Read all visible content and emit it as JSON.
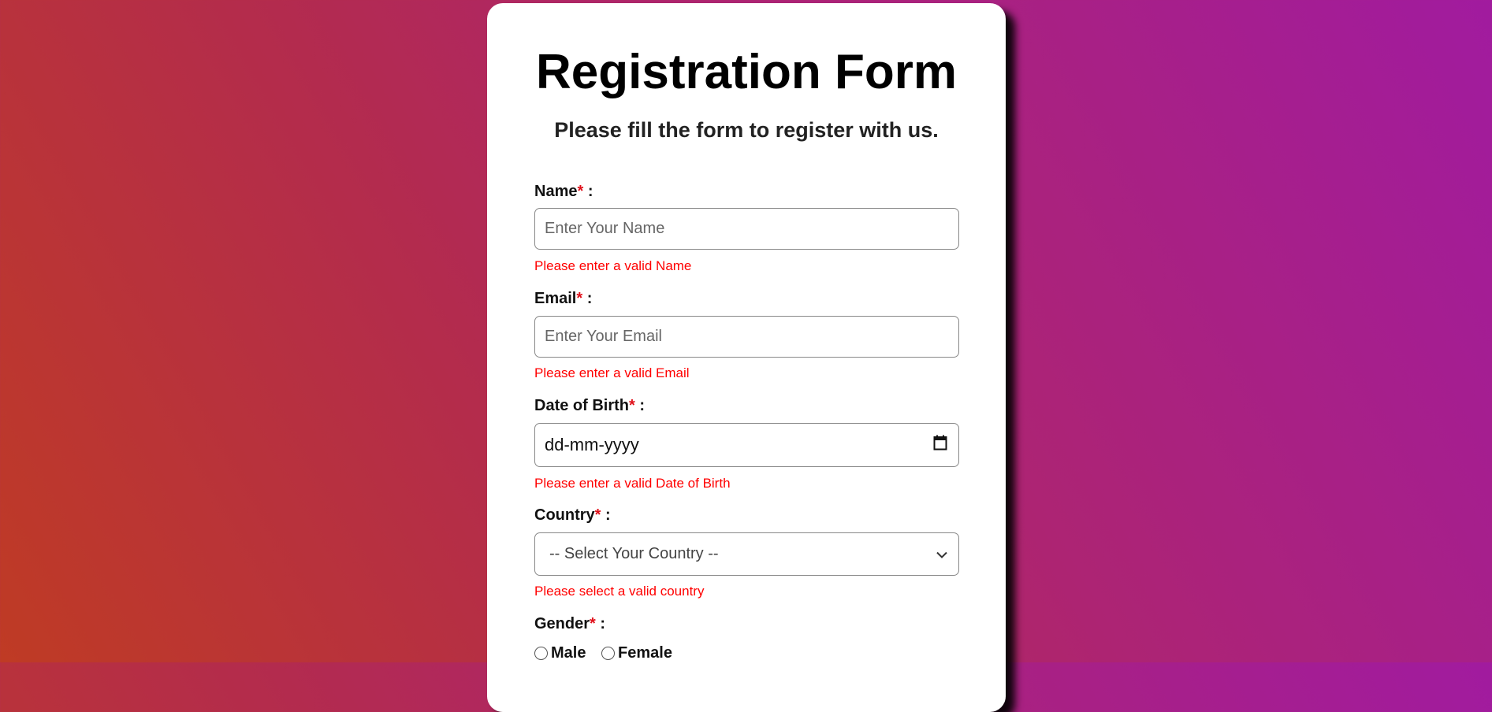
{
  "form": {
    "title": "Registration Form",
    "subtitle": "Please fill the form to register with us.",
    "required_mark": "*",
    "separator": " :",
    "fields": {
      "name": {
        "label": "Name",
        "placeholder": "Enter Your Name",
        "error": "Please enter a valid Name"
      },
      "email": {
        "label": "Email",
        "placeholder": "Enter Your Email",
        "error": "Please enter a valid Email"
      },
      "dob": {
        "label": "Date of Birth",
        "placeholder": "dd-mm-yyyy",
        "error": "Please enter a valid Date of Birth",
        "icon": "calendar-icon"
      },
      "country": {
        "label": "Country",
        "selected": "-- Select Your Country --",
        "error": "Please select a valid country",
        "icon": "chevron-down-icon"
      },
      "gender": {
        "label": "Gender",
        "options": [
          "Male",
          "Female"
        ]
      }
    }
  },
  "colors": {
    "error": "#ff0000",
    "required": "#e0101a",
    "gradient_start": "#bf3b24",
    "gradient_end": "#a11b9f"
  }
}
